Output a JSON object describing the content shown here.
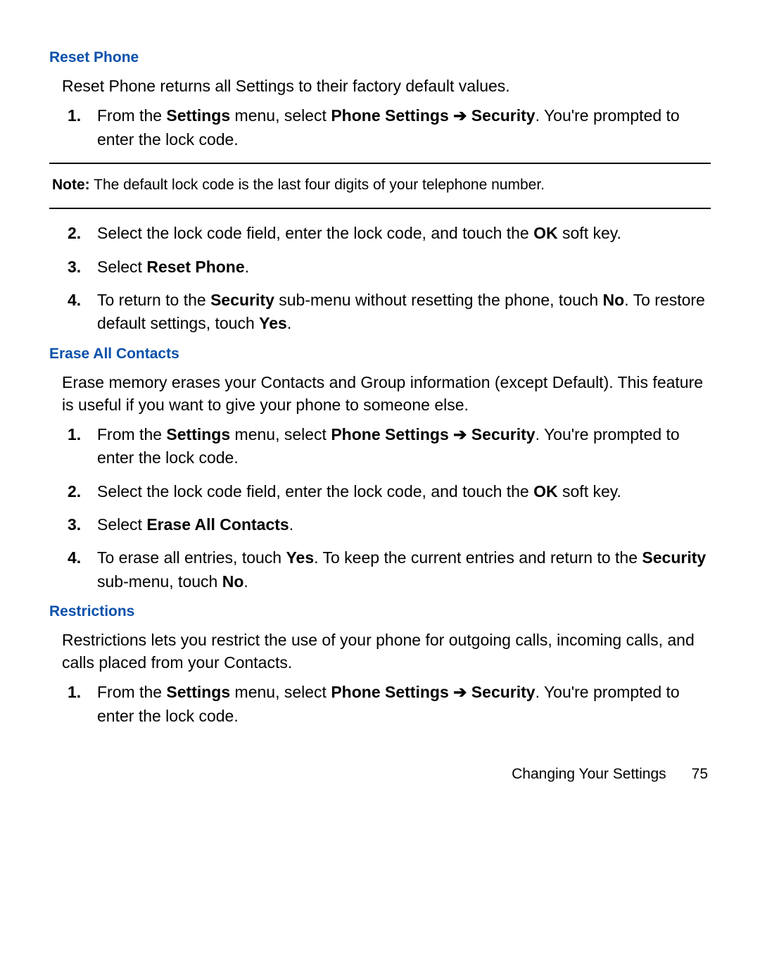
{
  "arrow_glyph": "➔",
  "sections": {
    "reset_phone": {
      "heading": "Reset Phone",
      "intro": "Reset Phone returns all Settings to their factory default values.",
      "step1": {
        "num": "1.",
        "t1": "From the ",
        "b1": "Settings",
        "t2": " menu, select ",
        "b2": "Phone Settings ",
        "b3": " Security",
        "t3": ". You're prompted to enter the lock code."
      },
      "note_b": "Note:",
      "note_t": " The default lock code is the last four digits of your telephone number.",
      "step2": {
        "num": "2.",
        "t1": "Select the lock code field, enter the lock code, and touch the ",
        "b1": "OK",
        "t2": " soft key."
      },
      "step3": {
        "num": "3.",
        "t1": "Select ",
        "b1": "Reset Phone",
        "t2": "."
      },
      "step4": {
        "num": "4.",
        "t1": "To return to the ",
        "b1": "Security",
        "t2": " sub-menu without resetting the phone, touch ",
        "b2": "No",
        "t3": ". To restore default settings, touch ",
        "b3": "Yes",
        "t4": "."
      }
    },
    "erase_all": {
      "heading": "Erase All Contacts",
      "intro": "Erase memory erases your Contacts and Group information (except Default). This feature is useful if you want to give your phone to someone else.",
      "step1": {
        "num": "1.",
        "t1": "From the ",
        "b1": "Settings",
        "t2": " menu, select ",
        "b2": "Phone Settings ",
        "b3": " Security",
        "t3": ". You're prompted to enter the lock code."
      },
      "step2": {
        "num": "2.",
        "t1": "Select the lock code field, enter the lock code, and touch the ",
        "b1": "OK",
        "t2": " soft key."
      },
      "step3": {
        "num": "3.",
        "t1": "Select ",
        "b1": "Erase All Contacts",
        "t2": "."
      },
      "step4": {
        "num": "4.",
        "t1": "To erase all entries, touch ",
        "b1": "Yes",
        "t2": ". To keep the current entries and return to the ",
        "b2": "Security",
        "t3": " sub-menu, touch ",
        "b3": "No",
        "t4": "."
      }
    },
    "restrictions": {
      "heading": "Restrictions",
      "intro": "Restrictions lets you restrict the use of your phone for outgoing calls, incoming calls, and calls placed from your Contacts.",
      "step1": {
        "num": "1.",
        "t1": "From the ",
        "b1": "Settings",
        "t2": " menu, select ",
        "b2": "Phone Settings ",
        "b3": " Security",
        "t3": ". You're prompted to enter the lock code."
      }
    }
  },
  "footer": {
    "title": "Changing Your Settings",
    "page": "75"
  }
}
